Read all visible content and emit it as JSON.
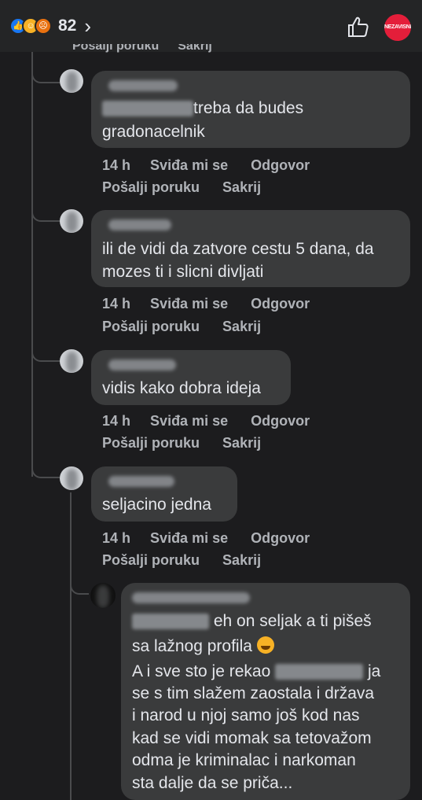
{
  "header": {
    "reaction_count": "82",
    "reactions": [
      "like-icon",
      "haha-icon",
      "angry-icon"
    ],
    "brand_text": "NEZAVISNE"
  },
  "labels": {
    "time": "14 h",
    "like": "Sviđa mi se",
    "reply": "Odgovor",
    "message": "Pošalji poruku",
    "hide": "Sakrij"
  },
  "comments": [
    {
      "line1": "treba da budes",
      "line2": "gradonacelnik"
    },
    {
      "line1": "ili de vidi da zatvore cestu 5 dana, da",
      "line2": "mozes ti i slicni divljati"
    },
    {
      "line1": "vidis kako dobra ideja"
    },
    {
      "line1": "seljacino jedna"
    }
  ],
  "reply": {
    "line1": "eh on seljak a ti pišeš",
    "line2": "sa lažnog profila",
    "line3a": "A i sve sto je rekao",
    "line3b": "ja",
    "line4": "se s tim slažem zaostala i država",
    "line5": "i narod u njoj samo još kod nas",
    "line6": "kad se vidi momak sa tetovažom",
    "line7": "odma je kriminalac i narkoman",
    "line8": "sta dalje da se priča..."
  },
  "colors": {
    "background": "#1c1c1e",
    "bubble": "#3a3b3c",
    "like_blue": "#1877f2",
    "haha_yellow": "#f7b125",
    "brand_red": "#e41e3a"
  }
}
